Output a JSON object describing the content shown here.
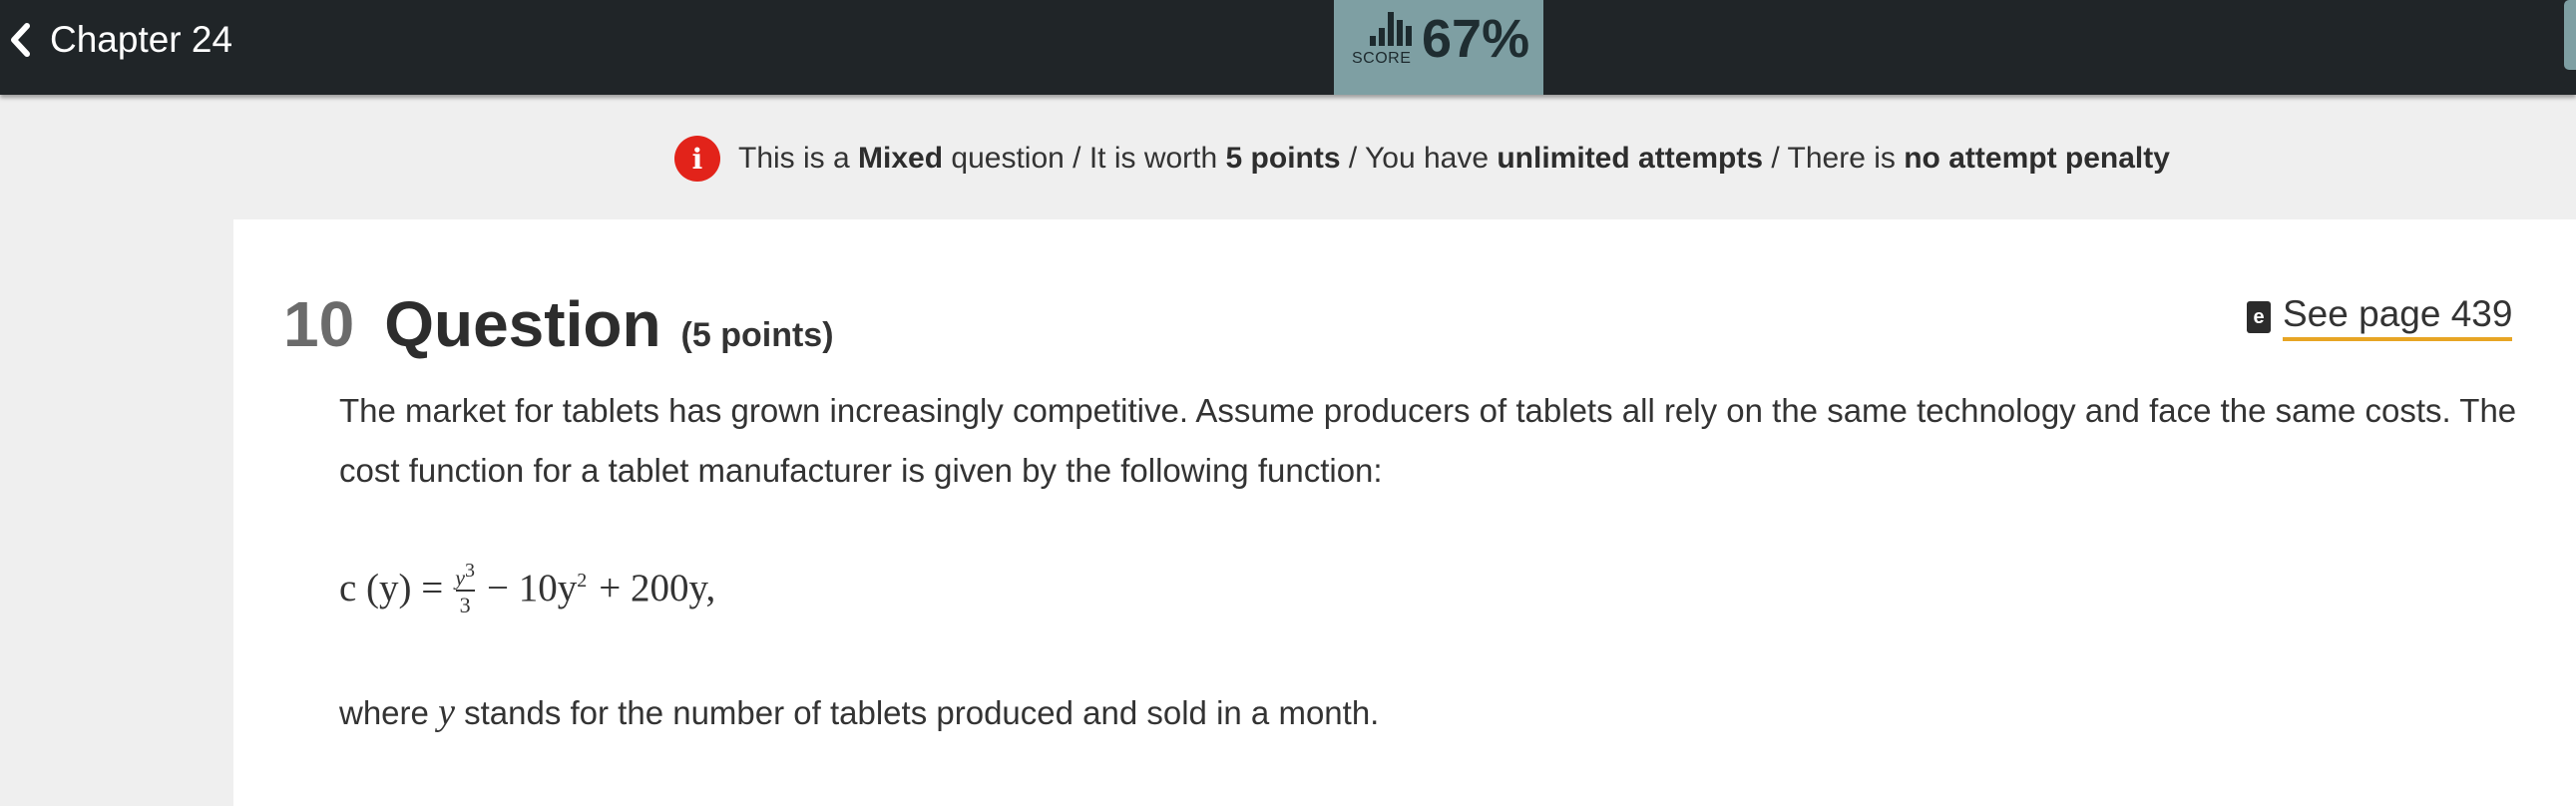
{
  "topbar": {
    "back_label": "Chapter 24",
    "score_label": "SCORE",
    "score_value": "67%"
  },
  "info": {
    "t1": "This is a ",
    "type": "Mixed",
    "t2": " question / It is worth ",
    "worth": "5 points",
    "t3": " / You have ",
    "attempts": "unlimited attempts",
    "t4": " / There is ",
    "penalty": "no attempt penalty"
  },
  "question": {
    "number": "10",
    "title": "Question",
    "points": "(5 points)",
    "see_page": "See page 439",
    "book_glyph": "e",
    "text": "The market for tablets has grown increasingly competitive. Assume producers of tablets all rely on the same technology and face the same costs. The cost function for a tablet manufacturer is given by the following function:",
    "formula": {
      "lhs": "c (y) =",
      "frac_num": "y",
      "frac_num_exp": "3",
      "frac_den": "3",
      "term2": "− 10y",
      "term2_exp": "2",
      "term3": "+ 200y,"
    },
    "where_pre": "where ",
    "where_var": "y",
    "where_post": " stands for the number of tablets produced and sold in a month."
  },
  "colors": {
    "topbar": "#202528",
    "score_bg": "#7e9fa3",
    "info_icon": "#e2231a",
    "link_underline": "#e7a524"
  }
}
